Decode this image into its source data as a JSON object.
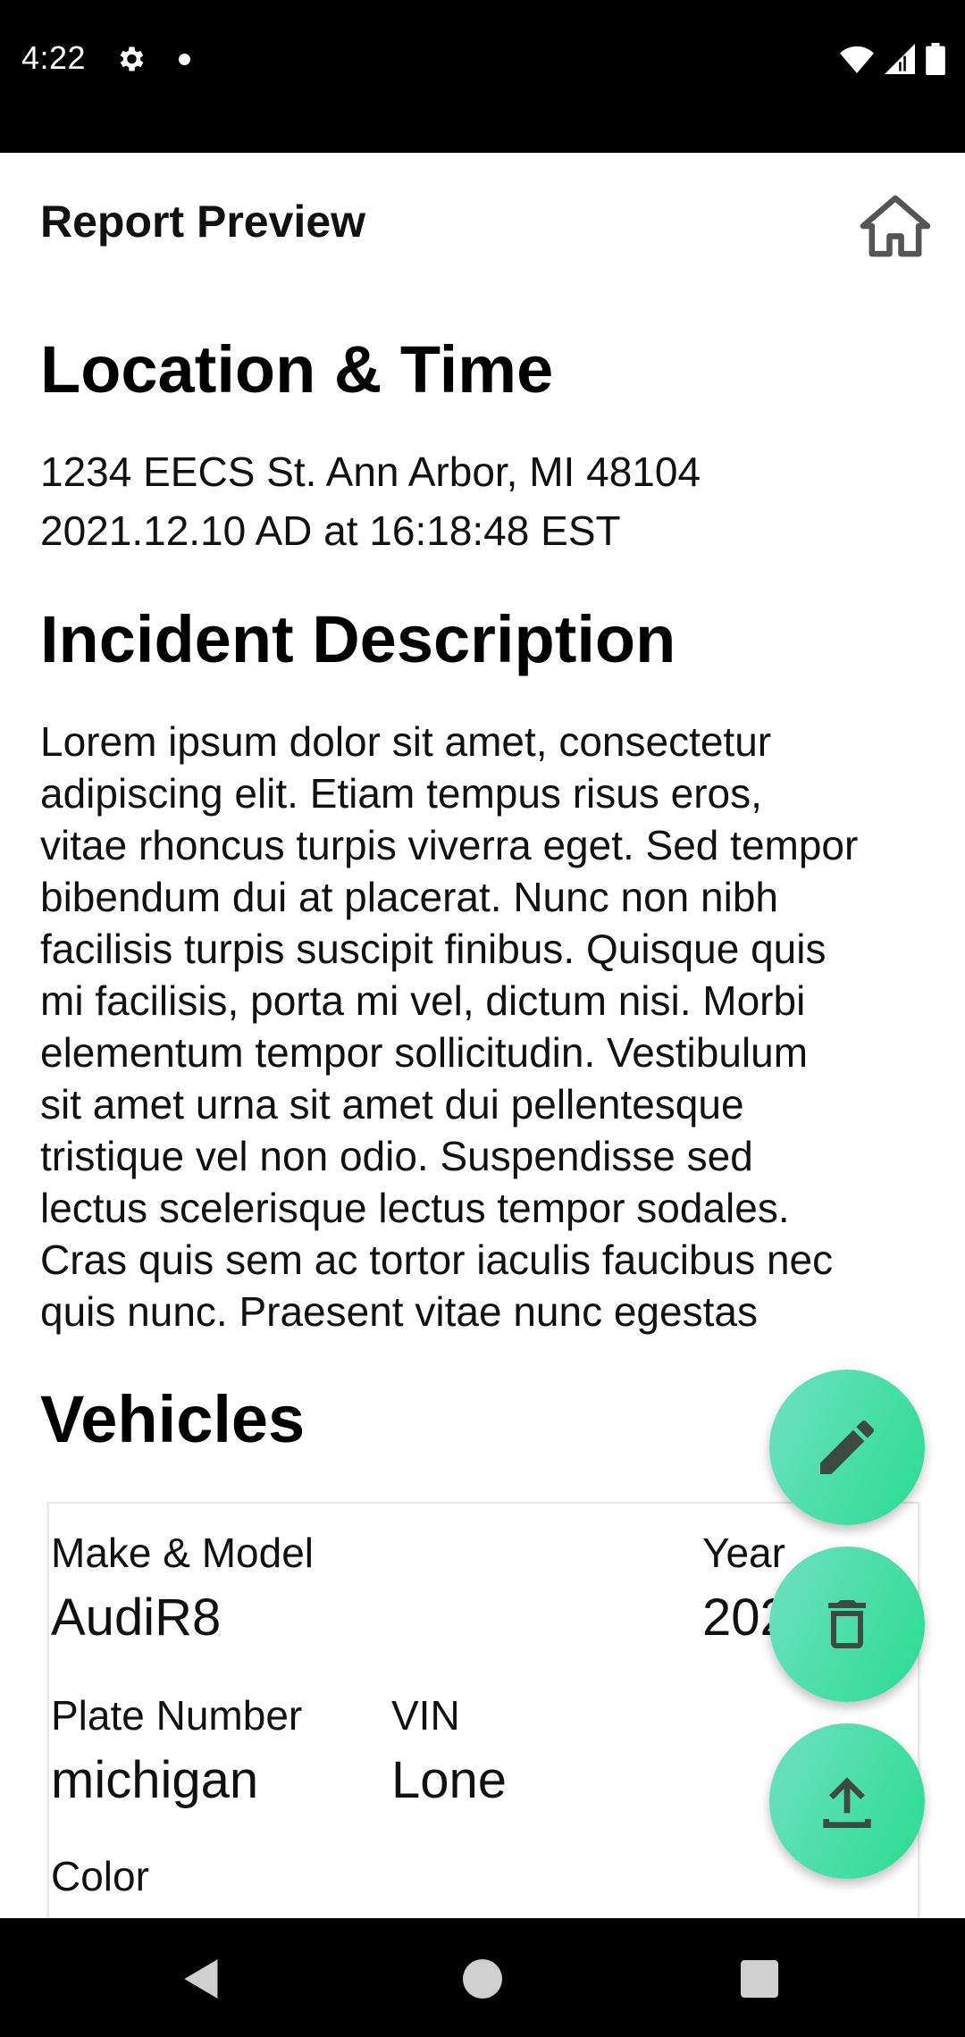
{
  "status_bar": {
    "time": "4:22",
    "icons": [
      "gear-icon",
      "dot-icon",
      "wifi-icon",
      "signal-icon",
      "battery-icon"
    ]
  },
  "toolbar": {
    "title": "Report Preview",
    "home_icon": "home-icon"
  },
  "location_time": {
    "heading": "Location & Time",
    "address": "1234 EECS St. Ann Arbor, MI 48104",
    "datetime": "2021.12.10 AD at 16:18:48 EST"
  },
  "incident": {
    "heading": "Incident Description",
    "lines": [
      "Lorem ipsum dolor sit amet, consectetur",
      "adipiscing elit. Etiam tempus risus eros,",
      "vitae rhoncus turpis viverra eget. Sed tempor",
      "bibendum dui at placerat. Nunc non nibh",
      "facilisis turpis suscipit finibus. Quisque quis",
      "mi facilisis, porta mi vel, dictum nisi. Morbi",
      "elementum tempor sollicitudin. Vestibulum",
      "sit amet urna sit amet dui pellentesque",
      "tristique vel non odio. Suspendisse sed",
      "lectus scelerisque lectus tempor sodales.",
      "Cras quis sem ac tortor iaculis faucibus nec",
      "quis nunc. Praesent vitae nunc egestas"
    ]
  },
  "vehicles": {
    "heading": "Vehicles",
    "make_model_label": "Make & Model",
    "make_model_value": "AudiR8",
    "year_label": "Year",
    "year_value": "202",
    "plate_label": "Plate Number",
    "plate_value": "michigan",
    "vin_label": "VIN",
    "vin_value": "Lone",
    "color_label": "Color"
  },
  "fabs": {
    "edit_icon": "pencil-icon",
    "delete_icon": "trash-icon",
    "share_icon": "upload-icon",
    "gradient": [
      "#6fe0c1",
      "#2bdc92"
    ]
  },
  "nav": {
    "icons": [
      "back-icon",
      "home-circle-icon",
      "recents-icon"
    ]
  }
}
